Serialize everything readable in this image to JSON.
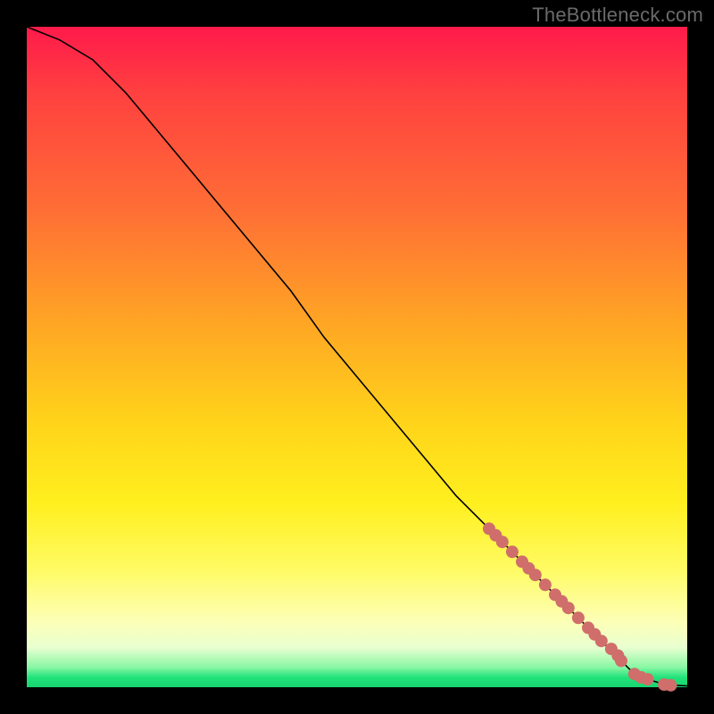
{
  "watermark": "TheBottleneck.com",
  "chart_data": {
    "type": "line",
    "title": "",
    "xlabel": "",
    "ylabel": "",
    "xlim": [
      0,
      100
    ],
    "ylim": [
      0,
      100
    ],
    "grid": false,
    "series": [
      {
        "name": "curve",
        "x": [
          0,
          5,
          10,
          15,
          20,
          25,
          30,
          35,
          40,
          45,
          50,
          55,
          60,
          65,
          70,
          75,
          80,
          85,
          88,
          90,
          92,
          94,
          96,
          98,
          100
        ],
        "y": [
          100,
          98,
          95,
          90,
          84,
          78,
          72,
          66,
          60,
          53,
          47,
          41,
          35,
          29,
          24,
          19,
          14,
          9,
          6,
          4,
          2,
          1.2,
          0.6,
          0.3,
          0.2
        ]
      }
    ],
    "points": {
      "name": "markers",
      "x": [
        70,
        71,
        72,
        73.5,
        75,
        76,
        77,
        78.5,
        80,
        81,
        82,
        83.5,
        85,
        86,
        87,
        88.5,
        89.5,
        90,
        92,
        93,
        94,
        96.5,
        97.5
      ],
      "y": [
        24,
        23,
        22,
        20.5,
        19,
        18,
        17,
        15.5,
        14,
        13,
        12,
        10.5,
        9,
        8,
        7,
        5.8,
        4.8,
        4,
        2,
        1.5,
        1.2,
        0.4,
        0.3
      ]
    },
    "colors": {
      "gradient_top": "#ff1a4b",
      "gradient_mid": "#ffd41a",
      "gradient_bottom": "#18d56e",
      "curve": "#000000",
      "markers": "#cf6e6b"
    }
  }
}
